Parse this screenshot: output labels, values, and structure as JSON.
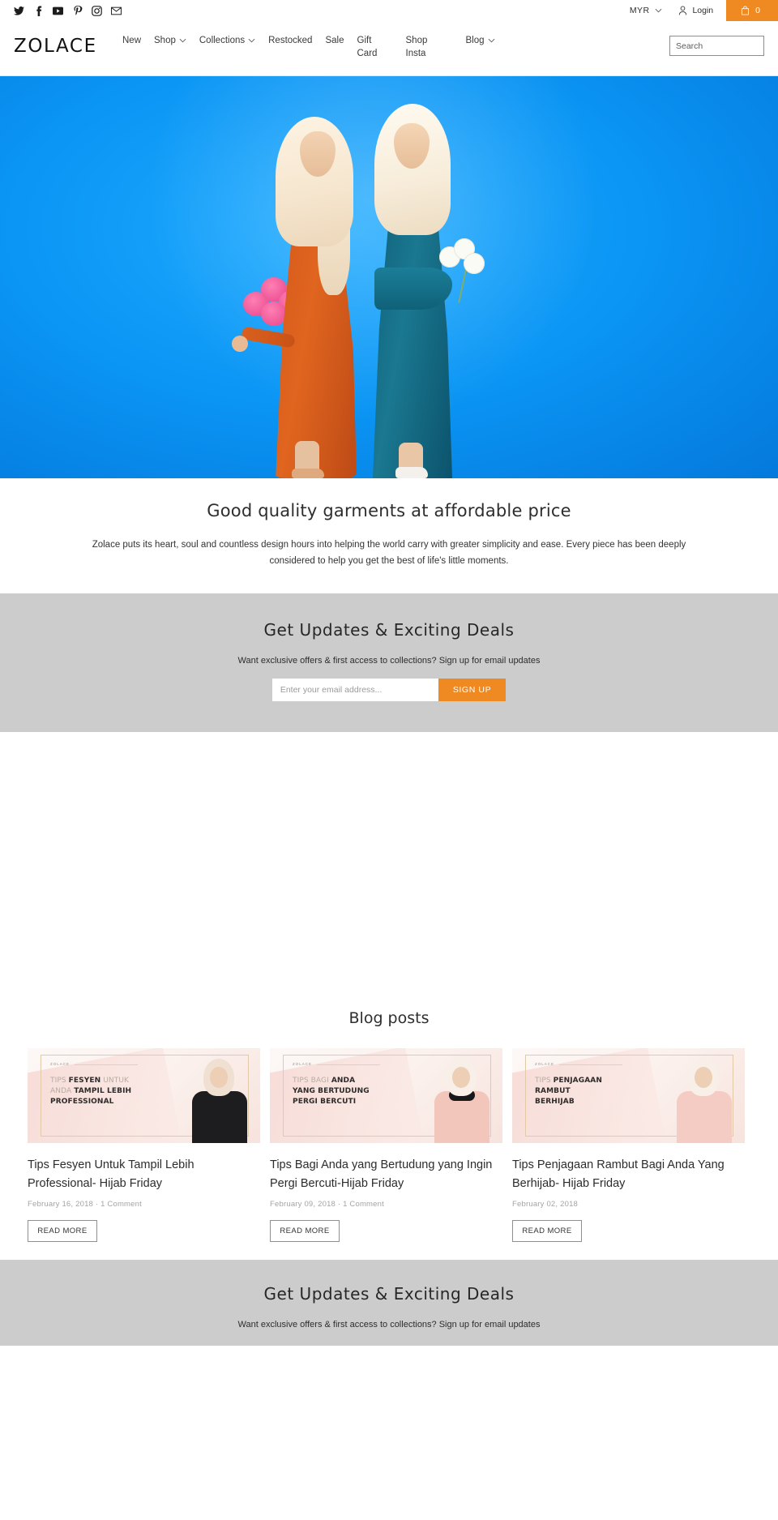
{
  "topbar": {
    "social": [
      {
        "name": "twitter-icon",
        "label": "Twitter"
      },
      {
        "name": "facebook-icon",
        "label": "Facebook"
      },
      {
        "name": "youtube-icon",
        "label": "YouTube"
      },
      {
        "name": "pinterest-icon",
        "label": "Pinterest"
      },
      {
        "name": "instagram-icon",
        "label": "Instagram"
      },
      {
        "name": "email-icon",
        "label": "Email"
      }
    ],
    "currency": "MYR",
    "login_label": "Login",
    "cart_count": "0"
  },
  "header": {
    "logo": "ZOLACE",
    "nav": [
      {
        "label": "New",
        "caret": false
      },
      {
        "label": "Shop",
        "caret": true
      },
      {
        "label": "Collections",
        "caret": true
      },
      {
        "label": "Restocked",
        "caret": false
      },
      {
        "label": "Sale",
        "caret": false
      },
      {
        "label": "Gift Card",
        "caret": false
      },
      {
        "label": "Shop Insta",
        "caret": false
      },
      {
        "label": "Blog",
        "caret": true
      }
    ],
    "search_placeholder": "Search"
  },
  "tagline": {
    "heading": "Good quality garments at affordable price",
    "body": "Zolace puts its heart, soul and countless design hours into helping the world carry with greater simplicity and ease. Every piece has been deeply considered to help you get the best of life's little moments."
  },
  "newsletter": {
    "heading": "Get Updates & Exciting Deals",
    "subtext": "Want exclusive offers & first access to collections? Sign up for email updates",
    "email_placeholder": "Enter your email address...",
    "button_label": "SIGN UP"
  },
  "blog": {
    "heading": "Blog posts",
    "read_more_label": "READ MORE",
    "posts": [
      {
        "title": "Tips Fesyen Untuk Tampil Lebih Professional- Hijab Friday",
        "date": "February 16, 2018",
        "comments": "1 Comment",
        "meta": "February 16, 2018  ·  1 Comment",
        "thumb_brand": "ZOLACE",
        "thumb_line1_light": "TIPS ",
        "thumb_line1_bold": "FESYEN",
        "thumb_line1_tail": " UNTUK",
        "thumb_line2_light": "ANDA ",
        "thumb_line2_bold": "TAMPIL LEBIH",
        "thumb_line3_bold": "PROFESSIONAL"
      },
      {
        "title": "Tips Bagi Anda yang Bertudung yang Ingin Pergi Bercuti-Hijab Friday",
        "date": "February 09, 2018",
        "comments": "1 Comment",
        "meta": "February 09, 2018  ·  1 Comment",
        "thumb_brand": "ZOLACE",
        "thumb_line1_light": "TIPS BAGI ",
        "thumb_line1_bold": "ANDA",
        "thumb_line1_tail": "",
        "thumb_line2_light": "",
        "thumb_line2_bold": "YANG BERTUDUNG",
        "thumb_line3_bold": "PERGI BERCUTI"
      },
      {
        "title": "Tips Penjagaan Rambut Bagi Anda Yang Berhijab- Hijab Friday",
        "date": "February 02, 2018",
        "comments": "",
        "meta": "February 02, 2018",
        "thumb_brand": "ZOLACE",
        "thumb_line1_light": "TIPS ",
        "thumb_line1_bold": "PENJAGAAN",
        "thumb_line1_tail": "",
        "thumb_line2_light": "",
        "thumb_line2_bold": "RAMBUT",
        "thumb_line3_bold": "BERHIJAB"
      }
    ]
  },
  "footer_newsletter": {
    "heading": "Get Updates & Exciting Deals",
    "subtext": "Want exclusive offers & first access to collections? Sign up for email updates"
  },
  "colors": {
    "accent_orange": "#ef8a22",
    "newsletter_bg": "#cccccc",
    "hero_blue": "#0b96f5"
  }
}
